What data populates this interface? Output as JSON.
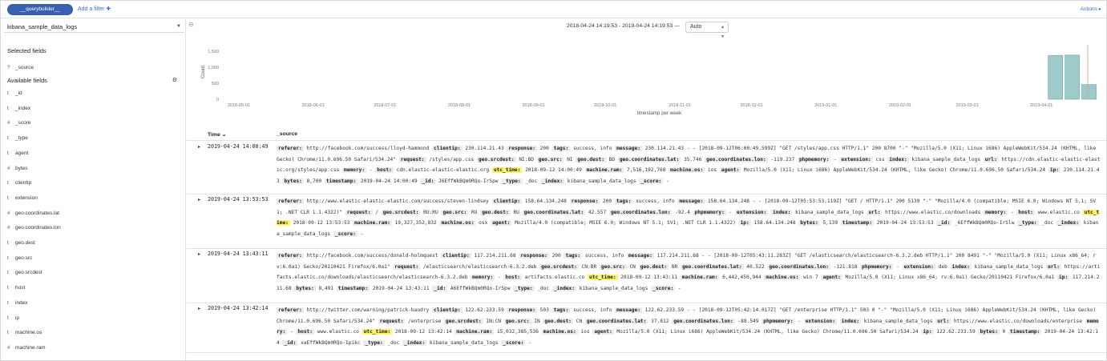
{
  "topbar": {
    "query_label": "__querybuilder__",
    "add_filter": "Add a filter ✚",
    "actions": "Actions ▸"
  },
  "sidebar": {
    "index_pattern": "kibana_sample_data_logs",
    "selected_title": "Selected fields",
    "selected_fields": [
      {
        "type": "?",
        "name": "_source"
      }
    ],
    "available_title": "Available fields",
    "available_fields": [
      {
        "type": "t",
        "name": "_id"
      },
      {
        "type": "t",
        "name": "_index"
      },
      {
        "type": "#",
        "name": "_score"
      },
      {
        "type": "t",
        "name": "_type"
      },
      {
        "type": "t",
        "name": "agent"
      },
      {
        "type": "#",
        "name": "bytes"
      },
      {
        "type": "t",
        "name": "clientip"
      },
      {
        "type": "t",
        "name": "extension"
      },
      {
        "type": "#",
        "name": "geo.coordinates.lat"
      },
      {
        "type": "#",
        "name": "geo.coordinates.lon"
      },
      {
        "type": "t",
        "name": "geo.dest"
      },
      {
        "type": "t",
        "name": "geo.src"
      },
      {
        "type": "t",
        "name": "geo.srcdest"
      },
      {
        "type": "t",
        "name": "host"
      },
      {
        "type": "t",
        "name": "index"
      },
      {
        "type": "t",
        "name": "ip"
      },
      {
        "type": "t",
        "name": "machine.os"
      },
      {
        "type": "#",
        "name": "machine.ram"
      }
    ]
  },
  "main": {
    "time_range": "2018-04-24 14:19:53 - 2019-04-24 14:19:53 —",
    "interval": "Auto",
    "table_header": {
      "time": "Time ⌄",
      "source": "_source"
    }
  },
  "chart_data": {
    "type": "bar",
    "ylabel": "Count",
    "xlabel": "timestamp per week",
    "y_ticks": [
      "0",
      "500",
      "1,000",
      "1,500"
    ],
    "ylim": [
      0,
      1700
    ],
    "x_tick_labels": [
      "2018-05-01",
      "2018-06-01",
      "2018-07-01",
      "2018-08-01",
      "2018-09-01",
      "2018-10-01",
      "2018-11-01",
      "2018-12-01",
      "2019-01-01",
      "2019-02-01",
      "2019-03-01",
      "2019-04-01"
    ],
    "bars": [
      {
        "x": "2019-04-07",
        "value": 1370
      },
      {
        "x": "2019-04-14",
        "value": 1380
      },
      {
        "x": "2019-04-21",
        "value": 460
      }
    ],
    "colors": {
      "bar": "#9ecbc9",
      "bar_stroke": "#6aa6a4",
      "marker": "#e0a3a3"
    }
  },
  "rows": [
    {
      "time": "2019-04-24 14:00:49",
      "fields": [
        {
          "k": "referer:",
          "v": "http://facebook.com/success/lloyd-hammond"
        },
        {
          "k": "clientip:",
          "v": "230.114.21.43"
        },
        {
          "k": "response:",
          "v": "200"
        },
        {
          "k": "tags:",
          "v": "success, info"
        },
        {
          "k": "message:",
          "v": "230.114.21.43 - - [2018-09-12T06:00:49.599Z] \"GET /styles/app.css HTTP/1.1\" 200 8700 \"-\" \"Mozilla/5.0 (X11; Linux i686) AppleWebKit/534.24 (KHTML, like Gecko) Chrome/11.0.696.50 Safari/534.24\""
        },
        {
          "k": "request:",
          "v": "/styles/app.css"
        },
        {
          "k": "geo.srcdest:",
          "v": "NI:BD"
        },
        {
          "k": "geo.src:",
          "v": "NI"
        },
        {
          "k": "geo.dest:",
          "v": "BD"
        },
        {
          "k": "geo.coordinates.lat:",
          "v": "35.746"
        },
        {
          "k": "geo.coordinates.lon:",
          "v": "-119.237"
        },
        {
          "k": "phpmemory:",
          "v": "-"
        },
        {
          "k": "extension:",
          "v": "css"
        },
        {
          "k": "index:",
          "v": "kibana_sample_data_logs"
        },
        {
          "k": "url:",
          "v": "https://cdn.elastic-elastic-elastic.org/styles/app.css"
        },
        {
          "k": "memory:",
          "v": "-"
        },
        {
          "k": "host:",
          "v": "cdn.elastic-elastic-elastic.org"
        },
        {
          "k": "utc_time:",
          "v": "2018-09-12 14:00:49",
          "hl": true
        },
        {
          "k": "machine.ram:",
          "v": "7,516,192,768"
        },
        {
          "k": "machine.os:",
          "v": "ios"
        },
        {
          "k": "agent:",
          "v": "Mozilla/5.0 (X11; Linux i686) AppleWebKit/534.24 (KHTML, like Gecko) Chrome/11.0.696.50 Safari/534.24"
        },
        {
          "k": "ip:",
          "v": "230.114.21.43"
        },
        {
          "k": "bytes:",
          "v": "8,700"
        },
        {
          "k": "timestamp:",
          "v": "2019-04-24 14:00:49"
        },
        {
          "k": "_id:",
          "v": "J6EffWkBQm0RQo-IrSpw"
        },
        {
          "k": "_type:",
          "v": "_doc"
        },
        {
          "k": "_index:",
          "v": "kibana_sample_data_logs"
        },
        {
          "k": "_score:",
          "v": "-"
        }
      ]
    },
    {
      "time": "2019-04-24 13:53:53",
      "fields": [
        {
          "k": "referer:",
          "v": "http://www.elastic-elastic-elastic.com/success/steven-lindsey"
        },
        {
          "k": "clientip:",
          "v": "158.64.134.248"
        },
        {
          "k": "response:",
          "v": "200"
        },
        {
          "k": "tags:",
          "v": "success, info"
        },
        {
          "k": "message:",
          "v": "158.64.134.248 - - [2018-09-12T05:53:53.119Z] \"GET / HTTP/1.1\" 200 5139 \"-\" \"Mozilla/4.0 (compatible; MSIE 6.0; Windows NT 5.1; SV1; .NET CLR 1.1.4322)\""
        },
        {
          "k": "request:",
          "v": "/"
        },
        {
          "k": "geo.srcdest:",
          "v": "RU:RU"
        },
        {
          "k": "geo.src:",
          "v": "RU"
        },
        {
          "k": "geo.dest:",
          "v": "RU"
        },
        {
          "k": "geo.coordinates.lat:",
          "v": "42.557"
        },
        {
          "k": "geo.coordinates.lon:",
          "v": "-92.4"
        },
        {
          "k": "phpmemory:",
          "v": "-"
        },
        {
          "k": "extension:",
          "v": ""
        },
        {
          "k": "index:",
          "v": "kibana_sample_data_logs"
        },
        {
          "k": "url:",
          "v": "https://www.elastic.co/downloads"
        },
        {
          "k": "memory:",
          "v": "-"
        },
        {
          "k": "host:",
          "v": "www.elastic.co"
        },
        {
          "k": "utc_time:",
          "v": "2018-09-12 13:53:53",
          "hl": true
        },
        {
          "k": "machine.ram:",
          "v": "19,327,352,832"
        },
        {
          "k": "machine.os:",
          "v": "osx"
        },
        {
          "k": "agent:",
          "v": "Mozilla/4.0 (compatible; MSIE 6.0; Windows NT 5.1; SV1; .NET CLR 1.1.4322)"
        },
        {
          "k": "ip:",
          "v": "158.64.134.248"
        },
        {
          "k": "bytes:",
          "v": "5,139"
        },
        {
          "k": "timestamp:",
          "v": "2019-04-24 13:53:53"
        },
        {
          "k": "_id:",
          "v": "_6EffWkBQm0RQo-IrSlw"
        },
        {
          "k": "_type:",
          "v": "_doc"
        },
        {
          "k": "_index:",
          "v": "kibana_sample_data_logs"
        },
        {
          "k": "_score:",
          "v": "-"
        }
      ]
    },
    {
      "time": "2019-04-24 13:43:11",
      "fields": [
        {
          "k": "referer:",
          "v": "http://facebook.com/success/donald-holmquest"
        },
        {
          "k": "clientip:",
          "v": "117.214.211.68"
        },
        {
          "k": "response:",
          "v": "200"
        },
        {
          "k": "tags:",
          "v": "success, info"
        },
        {
          "k": "message:",
          "v": "117.214.211.68 - - [2018-09-12T05:43:11.283Z] \"GET /elasticsearch/elasticsearch-6.3.2.deb HTTP/1.1\" 200 8491 \"-\" \"Mozilla/5.0 (X11; Linux x86_64; rv:6.0a1) Gecko/20110421 Firefox/6.0a1\""
        },
        {
          "k": "request:",
          "v": "/elasticsearch/elasticsearch-6.3.2.deb"
        },
        {
          "k": "geo.srcdest:",
          "v": "CN:BR"
        },
        {
          "k": "geo.src:",
          "v": "CN"
        },
        {
          "k": "geo.dest:",
          "v": "BR"
        },
        {
          "k": "geo.coordinates.lat:",
          "v": "40.522"
        },
        {
          "k": "geo.coordinates.lon:",
          "v": "-121.818"
        },
        {
          "k": "phpmemory:",
          "v": "-"
        },
        {
          "k": "extension:",
          "v": "deb"
        },
        {
          "k": "index:",
          "v": "kibana_sample_data_logs"
        },
        {
          "k": "url:",
          "v": "https://artifacts.elastic.co/downloads/elasticsearch/elasticsearch-6.3.2.deb"
        },
        {
          "k": "memory:",
          "v": "-"
        },
        {
          "k": "host:",
          "v": "artifacts.elastic.co"
        },
        {
          "k": "utc_time:",
          "v": "2018-09-12 13:43:11",
          "hl": true
        },
        {
          "k": "machine.ram:",
          "v": "6,442,450,944"
        },
        {
          "k": "machine.os:",
          "v": "win 7"
        },
        {
          "k": "agent:",
          "v": "Mozilla/5.0 (X11; Linux x86_64; rv:6.0a1) Gecko/20110421 Firefox/6.0a1"
        },
        {
          "k": "ip:",
          "v": "117.214.211.68"
        },
        {
          "k": "bytes:",
          "v": "8,491"
        },
        {
          "k": "timestamp:",
          "v": "2019-04-24 13:43:11"
        },
        {
          "k": "_id:",
          "v": "A6EffWkBQm0RQo-IrSpw"
        },
        {
          "k": "_type:",
          "v": "_doc"
        },
        {
          "k": "_index:",
          "v": "kibana_sample_data_logs"
        },
        {
          "k": "_score:",
          "v": "-"
        }
      ]
    },
    {
      "time": "2019-04-24 13:42:14",
      "fields": [
        {
          "k": "referer:",
          "v": "http://twitter.com/warning/patrick-baudry"
        },
        {
          "k": "clientip:",
          "v": "122.62.233.59"
        },
        {
          "k": "response:",
          "v": "503"
        },
        {
          "k": "tags:",
          "v": "success, info"
        },
        {
          "k": "message:",
          "v": "122.62.233.59 - - [2018-09-12T05:42:14.017Z] \"GET /enterprise HTTP/1.1\" 503 0 \"-\" \"Mozilla/5.0 (X11; Linux i686) AppleWebKit/534.24 (KHTML, like Gecko) Chrome/11.0.696.50 Safari/534.24\""
        },
        {
          "k": "request:",
          "v": "/enterprise"
        },
        {
          "k": "geo.srcdest:",
          "v": "IN:CN"
        },
        {
          "k": "geo.src:",
          "v": "IN"
        },
        {
          "k": "geo.dest:",
          "v": "CN"
        },
        {
          "k": "geo.coordinates.lat:",
          "v": "37.812"
        },
        {
          "k": "geo.coordinates.lon:",
          "v": "-88.549"
        },
        {
          "k": "phpmemory:",
          "v": "-"
        },
        {
          "k": "extension:",
          "v": ""
        },
        {
          "k": "index:",
          "v": "kibana_sample_data_logs"
        },
        {
          "k": "url:",
          "v": "https://www.elastic.co/downloads/enterprise"
        },
        {
          "k": "memory:",
          "v": "-"
        },
        {
          "k": "host:",
          "v": "www.elastic.co"
        },
        {
          "k": "utc_time:",
          "v": "2018-09-12 13:42:14",
          "hl": true
        },
        {
          "k": "machine.ram:",
          "v": "15,032,385,536"
        },
        {
          "k": "machine.os:",
          "v": "ios"
        },
        {
          "k": "agent:",
          "v": "Mozilla/5.0 (X11; Linux i686) AppleWebKit/534.24 (KHTML, like Gecko) Chrome/11.0.696.50 Safari/534.24"
        },
        {
          "k": "ip:",
          "v": "122.62.233.59"
        },
        {
          "k": "bytes:",
          "v": "0"
        },
        {
          "k": "timestamp:",
          "v": "2019-04-24 13:42:14"
        },
        {
          "k": "_id:",
          "v": "xaEffWkBQm0RQo-Ipikc"
        },
        {
          "k": "_type:",
          "v": "_doc"
        },
        {
          "k": "_index:",
          "v": "kibana_sample_data_logs"
        },
        {
          "k": "_score:",
          "v": "-"
        }
      ]
    }
  ]
}
